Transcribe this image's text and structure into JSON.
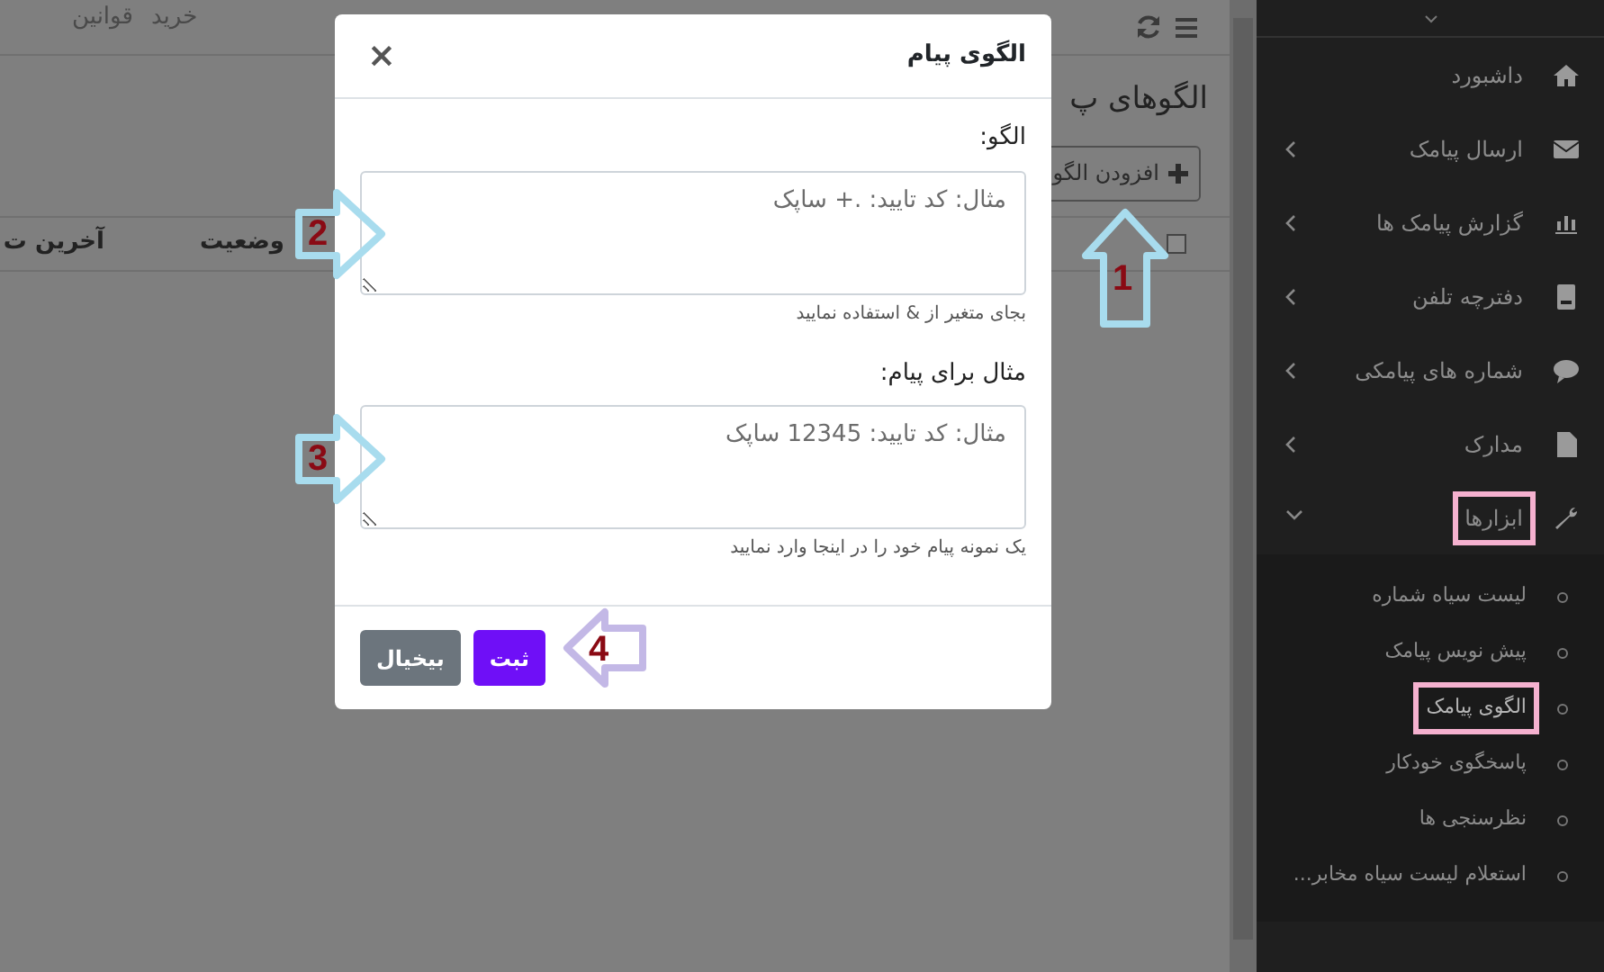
{
  "top_bar": {
    "links": [
      "خرید",
      "قوانین"
    ]
  },
  "page": {
    "title": "الگوهای پ",
    "add_button": "افزودن الگو",
    "table": {
      "select_all_checked": false,
      "columns": [
        "وضعیت",
        "آخرین ت"
      ]
    }
  },
  "modal": {
    "title": "الگوی پیام",
    "close": "×",
    "fields": [
      {
        "label": "الگو:",
        "placeholder": "مثال: کد تایید: .+ ساپک",
        "help": "بجای متغیر از & استفاده نمایید"
      },
      {
        "label": "مثال برای پیام:",
        "placeholder": "مثال: کد تایید: 12345 ساپک",
        "help": "یک نمونه پیام خود را در اینجا وارد نمایید"
      }
    ],
    "buttons": [
      {
        "label": "ثبت",
        "kind": "primary"
      },
      {
        "label": "بیخیال",
        "kind": "secondary"
      }
    ]
  },
  "sidebar": {
    "items": [
      {
        "label": "داشبورد",
        "kind": "link",
        "highlighted": false
      },
      {
        "label": "ارسال پیامک",
        "kind": "group",
        "expanded": false,
        "highlighted": false
      },
      {
        "label": "گزارش پیامک ها",
        "kind": "group",
        "expanded": false,
        "highlighted": false
      },
      {
        "label": "دفترچه تلفن",
        "kind": "group",
        "expanded": false,
        "highlighted": false
      },
      {
        "label": "شماره های پیامکی",
        "kind": "group",
        "expanded": false,
        "highlighted": false
      },
      {
        "label": "مدارک",
        "kind": "group",
        "expanded": false,
        "highlighted": false
      },
      {
        "label": "ابزارها",
        "kind": "group",
        "expanded": true,
        "highlighted": true,
        "children": [
          {
            "label": "لیست سیاه شماره",
            "selected": false,
            "highlighted": false
          },
          {
            "label": "پیش نویس پیامک",
            "selected": false,
            "highlighted": false
          },
          {
            "label": "الگوی پیامک",
            "selected": true,
            "highlighted": true
          },
          {
            "label": "پاسخگوی خودکار",
            "selected": false,
            "highlighted": false
          },
          {
            "label": "نظرسنجی ها",
            "selected": false,
            "highlighted": false
          },
          {
            "label": "استعلام لیست سیاه مخابر...",
            "selected": false,
            "highlighted": false
          }
        ]
      }
    ]
  },
  "annotations": [
    {
      "number": "1",
      "kind": "up",
      "color": "#a8dcee"
    },
    {
      "number": "2",
      "kind": "right",
      "color": "#a8dcee"
    },
    {
      "number": "3",
      "kind": "right",
      "color": "#a8dcee"
    },
    {
      "number": "4",
      "kind": "left",
      "color": "#c3b8e6"
    }
  ]
}
